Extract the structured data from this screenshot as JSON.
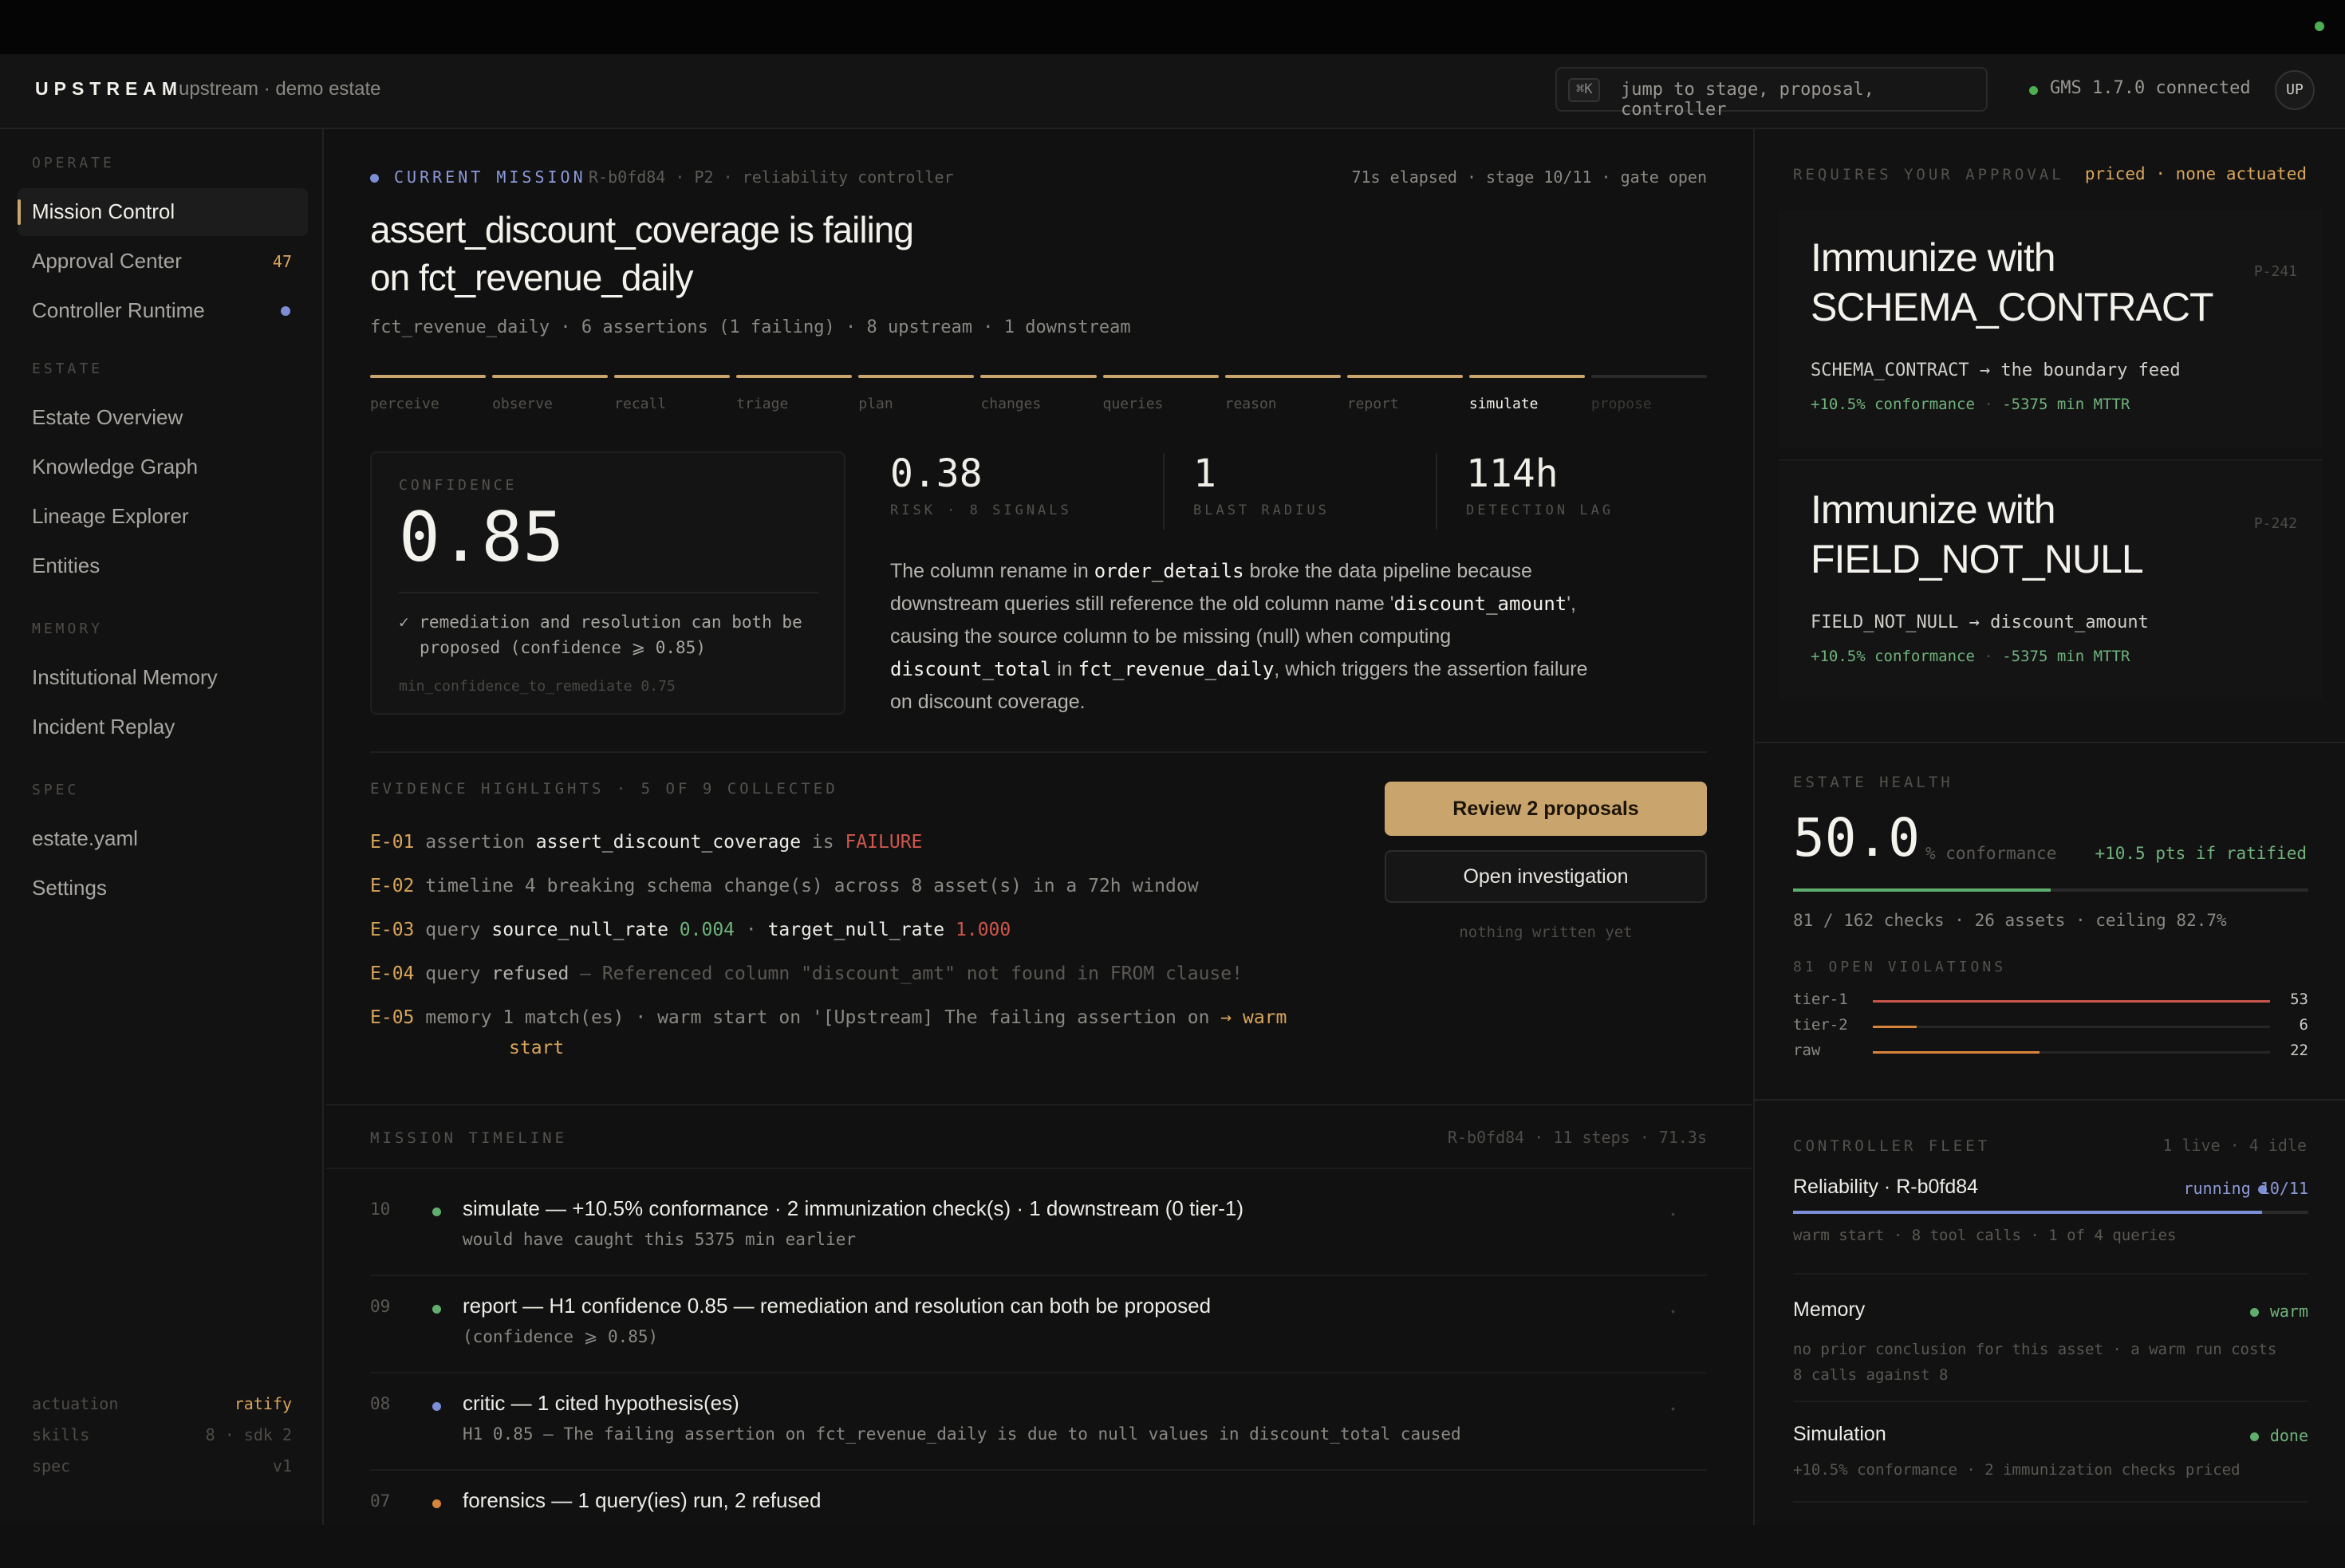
{
  "app": {
    "brand": "UPSTREAM",
    "estate": "upstream · demo estate",
    "search": {
      "kbd": "⌘K",
      "placeholder": "jump to stage, proposal, controller"
    },
    "connection": "GMS 1.7.0 connected",
    "avatar": "UP"
  },
  "sidebar": {
    "sections": [
      {
        "label": "OPERATE",
        "items": [
          {
            "label": "Mission Control",
            "active": true
          },
          {
            "label": "Approval Center",
            "badge": "47"
          },
          {
            "label": "Controller Runtime",
            "dot": true
          }
        ]
      },
      {
        "label": "ESTATE",
        "items": [
          {
            "label": "Estate Overview"
          },
          {
            "label": "Knowledge Graph"
          },
          {
            "label": "Lineage Explorer"
          },
          {
            "label": "Entities"
          }
        ]
      },
      {
        "label": "MEMORY",
        "items": [
          {
            "label": "Institutional Memory"
          },
          {
            "label": "Incident Replay"
          }
        ]
      },
      {
        "label": "SPEC",
        "items": [
          {
            "label": "estate.yaml"
          },
          {
            "label": "Settings"
          }
        ]
      }
    ],
    "footer": [
      {
        "key": "actuation",
        "value": "ratify",
        "accent": true
      },
      {
        "key": "skills",
        "value": "8 · sdk 2"
      },
      {
        "key": "spec",
        "value": "v1"
      }
    ]
  },
  "mission": {
    "eyebrow": "CURRENT MISSION",
    "meta": "R-b0fd84 · P2 · reliability controller",
    "status": "71s elapsed · stage 10/11 · gate open",
    "title_line1": "assert_discount_coverage is failing",
    "title_line2": "on fct_revenue_daily",
    "subtitle": "fct_revenue_daily · 6 assertions (1 failing) · 8 upstream · 1 downstream",
    "stages": [
      {
        "label": "perceive",
        "state": "done"
      },
      {
        "label": "observe",
        "state": "done"
      },
      {
        "label": "recall",
        "state": "done"
      },
      {
        "label": "triage",
        "state": "done"
      },
      {
        "label": "plan",
        "state": "done"
      },
      {
        "label": "changes",
        "state": "done"
      },
      {
        "label": "queries",
        "state": "done"
      },
      {
        "label": "reason",
        "state": "done"
      },
      {
        "label": "report",
        "state": "done"
      },
      {
        "label": "simulate",
        "state": "current"
      },
      {
        "label": "propose",
        "state": "pending"
      }
    ],
    "confidence": {
      "label": "CONFIDENCE",
      "value": "0.85",
      "note_line1": "✓ remediation and resolution can both be",
      "note_line2": "proposed (confidence ⩾ 0.85)",
      "threshold": "min_confidence_to_remediate 0.75"
    },
    "metrics": [
      {
        "value": "0.38",
        "label": "RISK · 8 SIGNALS"
      },
      {
        "value": "1",
        "label": "BLAST RADIUS"
      },
      {
        "value": "114h",
        "label": "DETECTION LAG"
      }
    ],
    "explanation": {
      "p1": "The column rename in ",
      "c1": "order_details",
      "p2": " broke the data pipeline because",
      "p3": "downstream queries still reference the old column name '",
      "c2": "discount_amount",
      "p4": "',",
      "p5": "causing the source column to be missing (null) when computing",
      "c3": "discount_total",
      "p6": " in ",
      "c4": "fct_revenue_daily",
      "p7": ", which triggers the assertion failure",
      "p8": "on discount coverage."
    }
  },
  "evidence": {
    "heading": "EVIDENCE HIGHLIGHTS · 5 OF 9 COLLECTED",
    "items": [
      {
        "id": "E-01",
        "kind": "assertion",
        "a": "assert_discount_coverage",
        "b": " is ",
        "c": "FAILURE"
      },
      {
        "id": "E-02",
        "kind": "timeline",
        "a": "4 breaking schema change(s) across 8 asset(s) in a 72h window"
      },
      {
        "id": "E-03",
        "kind": "query",
        "a": "source_null_rate",
        "b": "0.004",
        "sep": " · ",
        "c": "target_null_rate",
        "d": "1.000"
      },
      {
        "id": "E-04",
        "kind": "query",
        "a": "refused",
        "b": " — Referenced column \"discount_amt\" not found in FROM clause!"
      },
      {
        "id": "E-05",
        "kind": "memory",
        "a": "1 match(es) · warm start on '[Upstream] The failing assertion on ",
        "b": "→ warm",
        "c": "start"
      }
    ],
    "primary_button": "Review 2 proposals",
    "secondary_button": "Open investigation",
    "note": "nothing written yet"
  },
  "timeline": {
    "heading": "MISSION TIMELINE",
    "meta": "R-b0fd84 · 11 steps · 71.3s",
    "rows": [
      {
        "num": "10",
        "color": "#5fae6e",
        "title": "simulate — +10.5% conformance · 2 immunization check(s) · 1 downstream (0 tier-1)",
        "sub": "would have caught this 5375 min earlier"
      },
      {
        "num": "09",
        "color": "#5fae6e",
        "title": "report — H1 confidence 0.85 — remediation and resolution can both be proposed",
        "sub": "(confidence ⩾ 0.85)"
      },
      {
        "num": "08",
        "color": "#7c8fd6",
        "title": "critic — 1 cited hypothesis(es)",
        "sub": "H1 0.85 — The failing assertion on fct_revenue_daily is due to null values in discount_total caused"
      },
      {
        "num": "07",
        "color": "#d9843b",
        "title": "forensics — 1 query(ies) run, 2 refused",
        "sub": ""
      }
    ]
  },
  "approvals": {
    "heading": "REQUIRES YOUR APPROVAL",
    "status": "priced · none actuated",
    "cards": [
      {
        "title_line1": "Immunize with",
        "title_line2": "SCHEMA_CONTRACT",
        "id": "P-241",
        "rule": "SCHEMA_CONTRACT → the boundary feed",
        "impact": "+10.5% conformance",
        "mttr": "-5375 min MTTR"
      },
      {
        "title_line1": "Immunize with",
        "title_line2": "FIELD_NOT_NULL",
        "id": "P-242",
        "rule": "FIELD_NOT_NULL → discount_amount",
        "impact": "+10.5% conformance",
        "mttr": "-5375 min MTTR"
      }
    ]
  },
  "health": {
    "heading": "ESTATE HEALTH",
    "value": "50.0",
    "unit": "% conformance",
    "delta": "+10.5 pts if ratified",
    "conformance_fraction": 0.5,
    "detail": "81 / 162 checks · 26 assets · ceiling 82.7%",
    "violations_heading": "81 OPEN VIOLATIONS",
    "tiers": [
      {
        "name": "tier-1",
        "count": "53",
        "fraction": 1.0,
        "color": "#c9564b"
      },
      {
        "name": "tier-2",
        "count": "6",
        "fraction": 0.11,
        "color": "#d9843b"
      },
      {
        "name": "raw",
        "count": "22",
        "fraction": 0.42,
        "color": "#d9843b"
      }
    ]
  },
  "fleet": {
    "heading": "CONTROLLER FLEET",
    "meta": "1 live · 4 idle",
    "items": [
      {
        "name": "Reliability · R-b0fd84",
        "status": "running 10/11",
        "color": "#7c8fd6",
        "desc1": "warm start · 8 tool calls · 1 of 4 queries",
        "desc2": "",
        "progress": 0.91
      },
      {
        "name": "Memory",
        "status": "warm",
        "color": "#5fae6e",
        "desc1": "no prior conclusion for this asset · a warm run costs",
        "desc2": "8 calls against 8"
      },
      {
        "name": "Simulation",
        "status": "done",
        "color": "#5fae6e",
        "desc1": "+10.5% conformance · 2 immunization checks priced",
        "desc2": ""
      }
    ]
  },
  "colors": {
    "accent": "#c9a46c",
    "ok": "#5fae6e",
    "info": "#7c8fd6",
    "warn": "#d9843b",
    "fail": "#c9564b"
  }
}
